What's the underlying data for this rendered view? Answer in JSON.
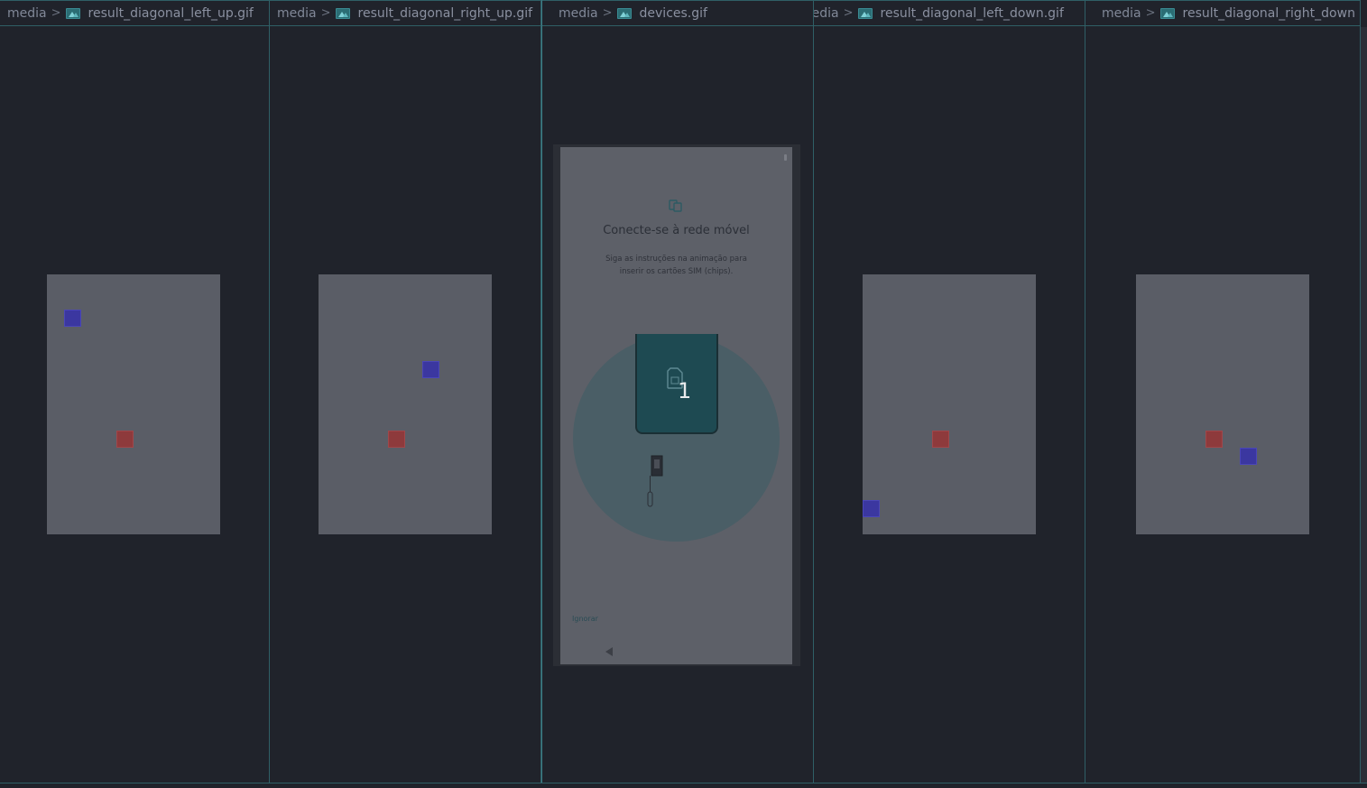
{
  "panes": [
    {
      "folder": "media",
      "separator": ">",
      "file": "result_diagonal_left_up.gif",
      "icon": "image-file-icon"
    },
    {
      "folder": "media",
      "separator": ">",
      "file": "result_diagonal_right_up.gif",
      "icon": "image-file-icon"
    },
    {
      "folder": "media",
      "separator": ">",
      "file": "devices.gif",
      "icon": "image-file-icon"
    },
    {
      "folder": "media",
      "separator": ">",
      "file": "result_diagonal_left_down.gif",
      "icon": "image-file-icon"
    },
    {
      "folder": "media",
      "separator": ">",
      "file": "result_diagonal_right_down",
      "icon": "image-file-icon"
    }
  ],
  "phone": {
    "title": "Conecte-se à rede móvel",
    "subtitle_line1": "Siga as instruções na animação para",
    "subtitle_line2": "inserir os cartões SIM (chips).",
    "step_number": "1",
    "ignore_label": "Ignorar"
  },
  "colors": {
    "background": "#20232b",
    "divider": "#2f5f66",
    "gif_canvas": "#5a5d66",
    "blue_square": "#3b37a0",
    "red_square": "#8e3a3c"
  }
}
